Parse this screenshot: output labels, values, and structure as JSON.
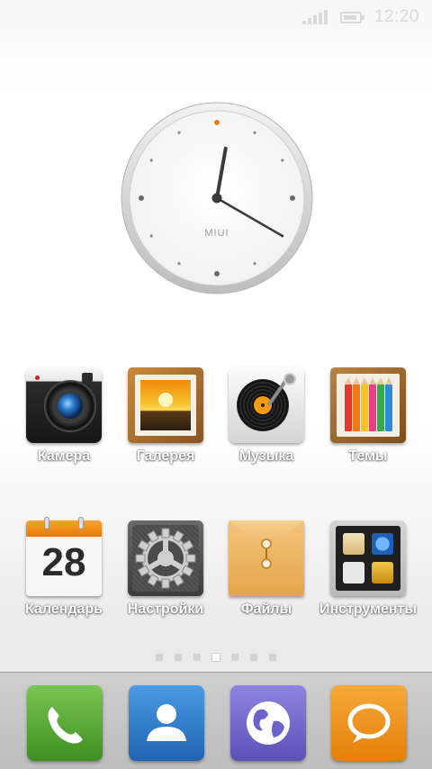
{
  "status_bar": {
    "time": "12:20",
    "signal_icon": "signal-icon",
    "battery_icon": "battery-icon",
    "battery_level": 0.9
  },
  "clock_widget": {
    "brand": "MIUI",
    "time": "12:20",
    "accent": "#f07a12"
  },
  "apps": [
    {
      "label": "Камера",
      "icon": "camera-icon"
    },
    {
      "label": "Галерея",
      "icon": "gallery-icon"
    },
    {
      "label": "Музыка",
      "icon": "music-icon"
    },
    {
      "label": "Темы",
      "icon": "themes-icon"
    },
    {
      "label": "Календарь",
      "icon": "calendar-icon",
      "date": "28"
    },
    {
      "label": "Настройки",
      "icon": "settings-gear-icon"
    },
    {
      "label": "Файлы",
      "icon": "files-envelope-icon"
    },
    {
      "label": "Инструменты",
      "icon": "tools-icon"
    }
  ],
  "page_indicator": {
    "pages": 7,
    "active_page": 4
  },
  "dock": [
    {
      "icon": "phone-icon",
      "color": "#55a534"
    },
    {
      "icon": "contacts-icon",
      "color": "#2f7fd0"
    },
    {
      "icon": "browser-globe-icon",
      "color": "#6b63c9"
    },
    {
      "icon": "messaging-icon",
      "color": "#f08a0e"
    }
  ]
}
